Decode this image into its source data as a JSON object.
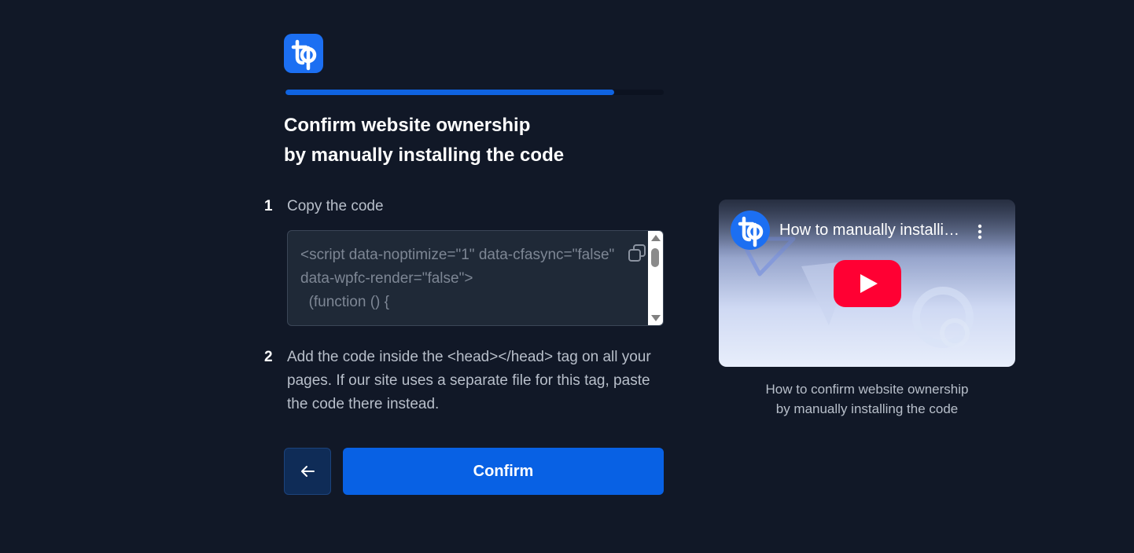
{
  "brand": {
    "logo_icon": "tp-logo-icon",
    "accent": "#0861e4"
  },
  "progress": {
    "value": 0.87
  },
  "title_line1": "Confirm website ownership",
  "title_line2": "by manually installing the code",
  "steps": [
    {
      "number": "1",
      "text": "Copy the code"
    },
    {
      "number": "2",
      "text": "Add the code inside the <head></head> tag on all your pages. If our site uses a separate file for this tag, paste the code there instead."
    }
  ],
  "code": {
    "snippet": "<script data-noptimize=\"1\" data-cfasync=\"false\" data-wpfc-render=\"false\">\n  (function () {",
    "copy_icon": "copy-icon"
  },
  "buttons": {
    "back_icon": "arrow-left-icon",
    "confirm_label": "Confirm"
  },
  "video": {
    "title": "How to manually installing the code",
    "caption_line1": "How to confirm website ownership",
    "caption_line2": "by manually installing the code",
    "play_icon": "youtube-play-icon",
    "menu_icon": "more-vertical-icon"
  }
}
